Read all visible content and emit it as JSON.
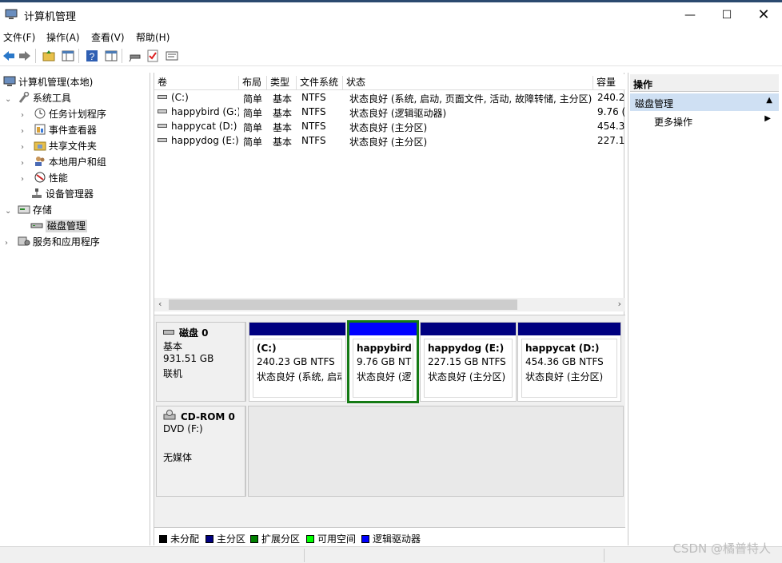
{
  "window": {
    "title": "计算机管理",
    "controls": {
      "minimize": "—",
      "maximize": "☐",
      "close": "✕"
    }
  },
  "menu": [
    "文件(F)",
    "操作(A)",
    "查看(V)",
    "帮助(H)"
  ],
  "toolbar_icons": [
    "back-arrow-icon",
    "forward-arrow-icon",
    "up-folder-icon",
    "show-tree-icon",
    "help-icon",
    "properties-icon",
    "connect-icon",
    "check-icon",
    "export-list-icon"
  ],
  "tree": {
    "root": "计算机管理(本地)",
    "system_tools": "系统工具",
    "task_scheduler": "任务计划程序",
    "event_viewer": "事件查看器",
    "shared_folders": "共享文件夹",
    "local_users": "本地用户和组",
    "performance": "性能",
    "device_manager": "设备管理器",
    "storage": "存储",
    "disk_management": "磁盘管理",
    "services": "服务和应用程序"
  },
  "volume_table": {
    "headers": [
      "卷",
      "布局",
      "类型",
      "文件系统",
      "状态",
      "容量"
    ],
    "rows": [
      {
        "volume": "(C:)",
        "layout": "简单",
        "type": "基本",
        "fs": "NTFS",
        "status": "状态良好 (系统, 启动, 页面文件, 活动, 故障转储, 主分区)",
        "capacity": "240.2"
      },
      {
        "volume": "happybird (G:)",
        "layout": "简单",
        "type": "基本",
        "fs": "NTFS",
        "status": "状态良好 (逻辑驱动器)",
        "capacity": "9.76 ("
      },
      {
        "volume": "happycat (D:)",
        "layout": "简单",
        "type": "基本",
        "fs": "NTFS",
        "status": "状态良好 (主分区)",
        "capacity": "454.3"
      },
      {
        "volume": "happydog (E:)",
        "layout": "简单",
        "type": "基本",
        "fs": "NTFS",
        "status": "状态良好 (主分区)",
        "capacity": "227.1"
      }
    ]
  },
  "disk0": {
    "name": "磁盘 0",
    "type": "基本",
    "size": "931.51 GB",
    "state": "联机",
    "partitions": [
      {
        "name": "(C:)",
        "size": "240.23 GB NTFS",
        "status": "状态良好 (系统, 启动",
        "color": "#000080"
      },
      {
        "name": "happybird",
        "size": "9.76 GB NT",
        "status": "状态良好 (逻",
        "color": "#0000ff"
      },
      {
        "name": "happydog  (E:)",
        "size": "227.15 GB NTFS",
        "status": "状态良好 (主分区)",
        "color": "#000080"
      },
      {
        "name": "happycat  (D:)",
        "size": "454.36 GB NTFS",
        "status": "状态良好 (主分区)",
        "color": "#000080"
      }
    ]
  },
  "cdrom": {
    "name": "CD-ROM 0",
    "drive": "DVD (F:)",
    "media": "无媒体"
  },
  "legend": [
    {
      "label": "未分配",
      "color": "#000000"
    },
    {
      "label": "主分区",
      "color": "#000080"
    },
    {
      "label": "扩展分区",
      "color": "#008000"
    },
    {
      "label": "可用空间",
      "color": "#00ff00"
    },
    {
      "label": "逻辑驱动器",
      "color": "#0000ff"
    }
  ],
  "actions": {
    "title": "操作",
    "section": "磁盘管理",
    "more": "更多操作"
  },
  "watermark": "CSDN @橘普特人"
}
